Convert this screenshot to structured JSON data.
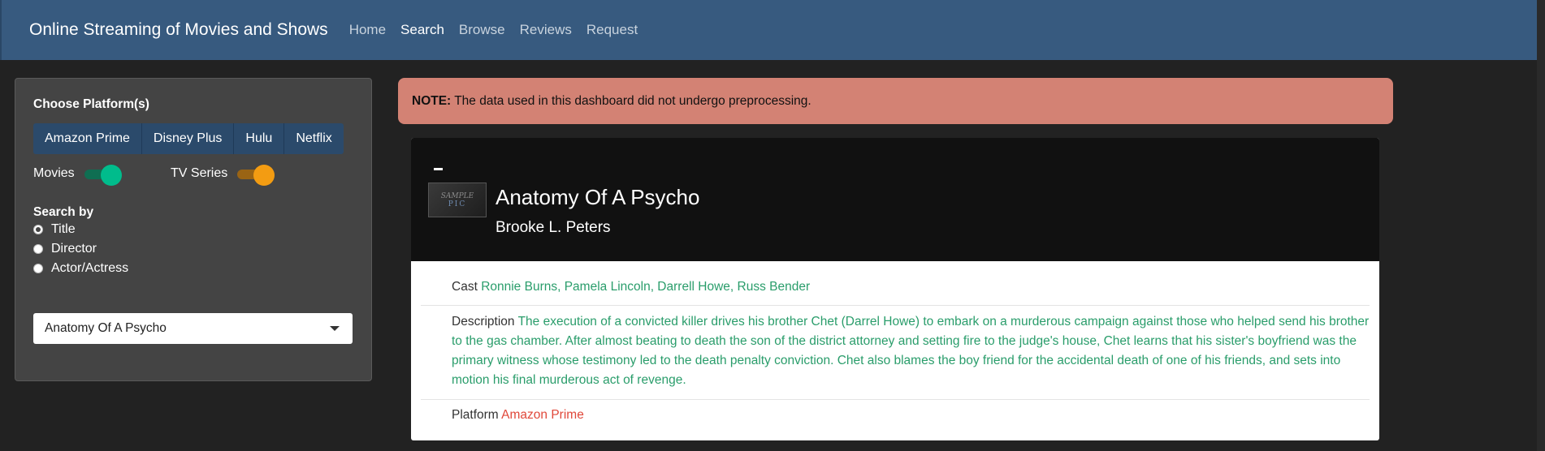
{
  "navbar": {
    "brand": "Online Streaming of Movies and Shows",
    "links": [
      {
        "label": "Home",
        "active": false
      },
      {
        "label": "Search",
        "active": true
      },
      {
        "label": "Browse",
        "active": false
      },
      {
        "label": "Reviews",
        "active": false
      },
      {
        "label": "Request",
        "active": false
      }
    ]
  },
  "sidebar": {
    "platform_heading": "Choose Platform(s)",
    "platforms": [
      "Amazon Prime",
      "Disney Plus",
      "Hulu",
      "Netflix"
    ],
    "toggles": {
      "movies": {
        "label": "Movies",
        "on": true,
        "color": "#00bc8c"
      },
      "tv_series": {
        "label": "TV Series",
        "on": true,
        "color": "#f39c12"
      }
    },
    "search_heading": "Search by",
    "search_options": [
      {
        "label": "Title",
        "checked": true
      },
      {
        "label": "Director",
        "checked": false
      },
      {
        "label": "Actor/Actress",
        "checked": false
      }
    ],
    "select_value": "Anatomy Of A Psycho"
  },
  "alert": {
    "strong": "NOTE:",
    "text": "The data used in this dashboard did not undergo preprocessing.",
    "color": "#d38274"
  },
  "card": {
    "thumbnail": {
      "line1": "SAMPLE",
      "line2": "PIC"
    },
    "title": "Anatomy Of A Psycho",
    "director": "Brooke L. Peters",
    "cast_label": "Cast",
    "cast_value": "Ronnie Burns, Pamela Lincoln, Darrell Howe, Russ Bender",
    "description_label": "Description",
    "description_value": "The execution of a convicted killer drives his brother Chet (Darrel Howe) to embark on a murderous campaign against those who helped send his brother to the gas chamber. After almost beating to death the son of the district attorney and setting fire to the judge's house, Chet learns that his sister's boyfriend was the primary witness whose testimony led to the death penalty conviction. Chet also blames the boy friend for the accidental death of one of his friends, and sets into motion his final murderous act of revenge.",
    "platform_label": "Platform",
    "platform_value": "Amazon Prime"
  }
}
